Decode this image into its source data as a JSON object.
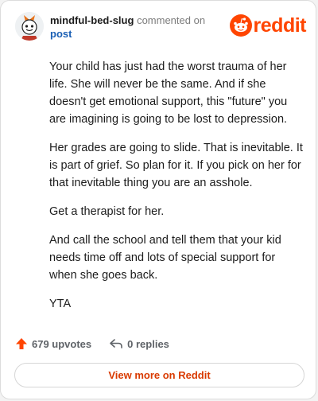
{
  "header": {
    "author": "mindful-bed-slug",
    "action": "commented on",
    "post_link": "post",
    "logo_text": "reddit"
  },
  "comment": {
    "paragraphs": [
      "Your child has just had the worst trauma of her life. She will never be the same. And if she doesn't get emotional support, this \"future\" you are imagining is going to be lost to depression.",
      "Her grades are going to slide. That is inevitable. It is part of grief. So plan for it. If you pick on her for that inevitable thing you are an asshole.",
      "Get a therapist for her.",
      "And call the school and tell them that your kid needs time off and lots of special support for when she goes back.",
      "YTA"
    ]
  },
  "footer": {
    "upvotes": "679 upvotes",
    "replies": "0 replies",
    "view_more": "View more on Reddit"
  },
  "icons": {
    "upvote": "upvote-arrow-icon",
    "reply": "reply-arrow-icon",
    "logo": "reddit-snoo-icon"
  },
  "colors": {
    "brand": "#ff4500",
    "link": "#1a5fb4",
    "view_more": "#d93a00"
  }
}
